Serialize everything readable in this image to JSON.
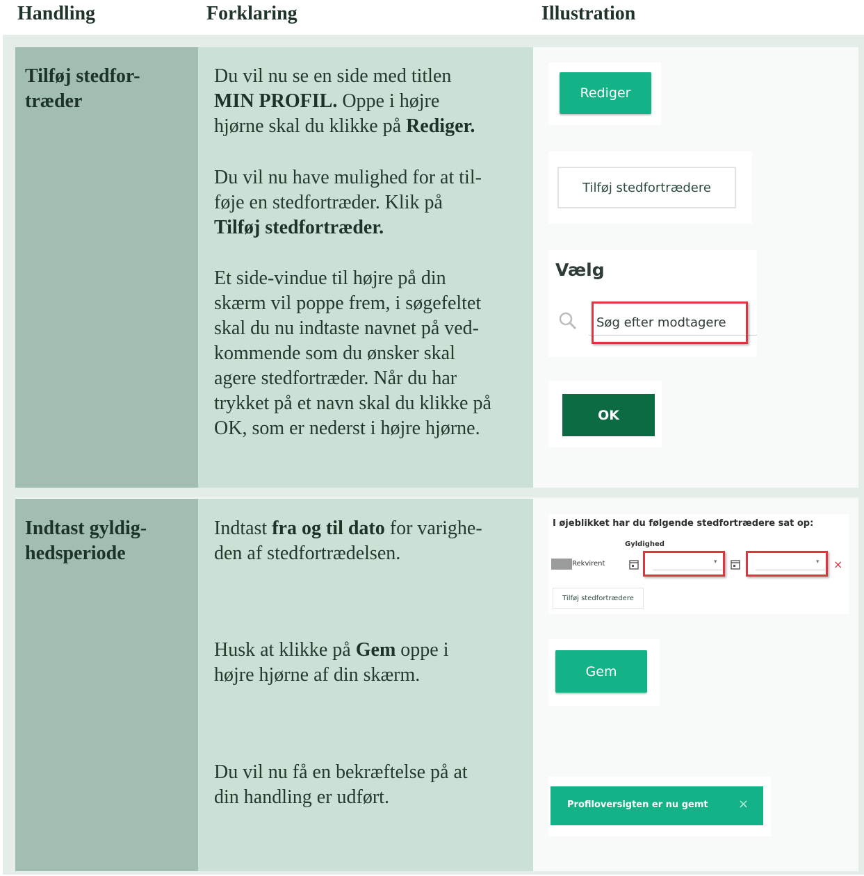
{
  "headers": {
    "col1": "Handling",
    "col2": "Forklaring",
    "col3": "Illustration"
  },
  "row1": {
    "handling": [
      "Tilføj stedfor-",
      "træder"
    ],
    "p1": {
      "l1": "Du vil nu se en side med titlen",
      "bold1": "MIN PROFIL.",
      "l2rest": " Oppe i højre",
      "l3": "hjørne skal du klikke på ",
      "bold2": "Rediger."
    },
    "p2": {
      "l1": "Du vil nu have mulighed for at til-",
      "l2": "føje en stedfortræder. Klik på",
      "bold": "Tilføj stedfortræder."
    },
    "p3": [
      "Et side-vindue til højre på din",
      "skærm vil poppe frem, i søgefeltet",
      "skal du nu indtaste navnet på ved-",
      "kommende som du ønsker skal",
      "agere stedfortræder. Når du har",
      "trykket på et navn skal du klikke på",
      "OK, som er nederst i højre hjørne."
    ],
    "illus": {
      "rediger_label": "Rediger",
      "tilfoj_label": "Tilføj stedfortrædere",
      "vaelg_title": "Vælg",
      "search_placeholder": "Søg efter modtagere",
      "ok_label": "OK"
    }
  },
  "row2": {
    "handling": [
      "Indtast gyldig-",
      "hedsperiode"
    ],
    "p1": {
      "pre": "Indtast ",
      "bold": "fra og til dato",
      "post": " for varighe-",
      "l2": "den af stedfortrædelsen."
    },
    "p2": {
      "pre": "Husk at klikke på ",
      "bold": "Gem",
      "post": " oppe i",
      "l2": "højre hjørne af din skærm."
    },
    "p3": [
      "Du vil nu få en bekræftelse på at",
      "din handling er udført."
    ],
    "illus": {
      "heading": "I øjeblikket har du følgende stedfortrædere sat op:",
      "col_label": "Gyldighed",
      "person": "Rekvirent",
      "tilfoj_label": "Tilføj stedfortrædere",
      "gem_label": "Gem",
      "toast_text": "Profiloversigten er nu gemt",
      "toast_close": "×",
      "remove_mark": "×"
    }
  },
  "colors": {
    "accent": "#14b287",
    "dark_green": "#0d6b44",
    "highlight_red": "#e0353f"
  }
}
